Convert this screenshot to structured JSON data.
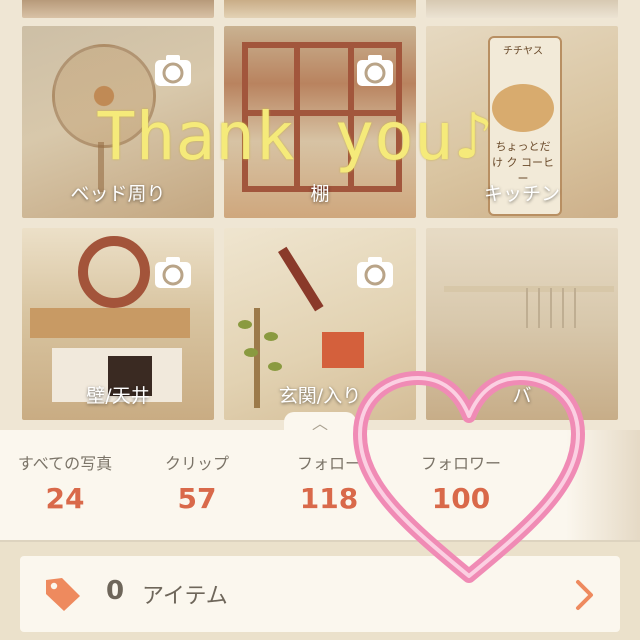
{
  "overlay": {
    "thanks_text": "Thank you♪"
  },
  "albums": [
    {
      "label": "ベッド周り"
    },
    {
      "label": "棚"
    },
    {
      "label": "キッチン"
    },
    {
      "label": "壁/天井"
    },
    {
      "label": "玄関/入り"
    },
    {
      "label": "バ"
    }
  ],
  "tile_text": {
    "milk_brand": "チチヤス",
    "milk_name": "ちょっとだけ ク コーヒー"
  },
  "stats": [
    {
      "label": "すべての写真",
      "value": "24"
    },
    {
      "label": "クリップ",
      "value": "57"
    },
    {
      "label": "フォロー",
      "value": "118"
    },
    {
      "label": "フォロワー",
      "value": "100"
    }
  ],
  "items": {
    "count": "0",
    "label": "アイテム"
  },
  "icons": {
    "album": "camera-icon",
    "tag": "tag-icon",
    "next": "chevron-right-icon",
    "collapse": "chevron-up-icon",
    "decoration": "heart-icon"
  },
  "colors": {
    "accent": "#d9694a",
    "heart": "#f08bb5",
    "thanks": "#f5ea7a"
  }
}
